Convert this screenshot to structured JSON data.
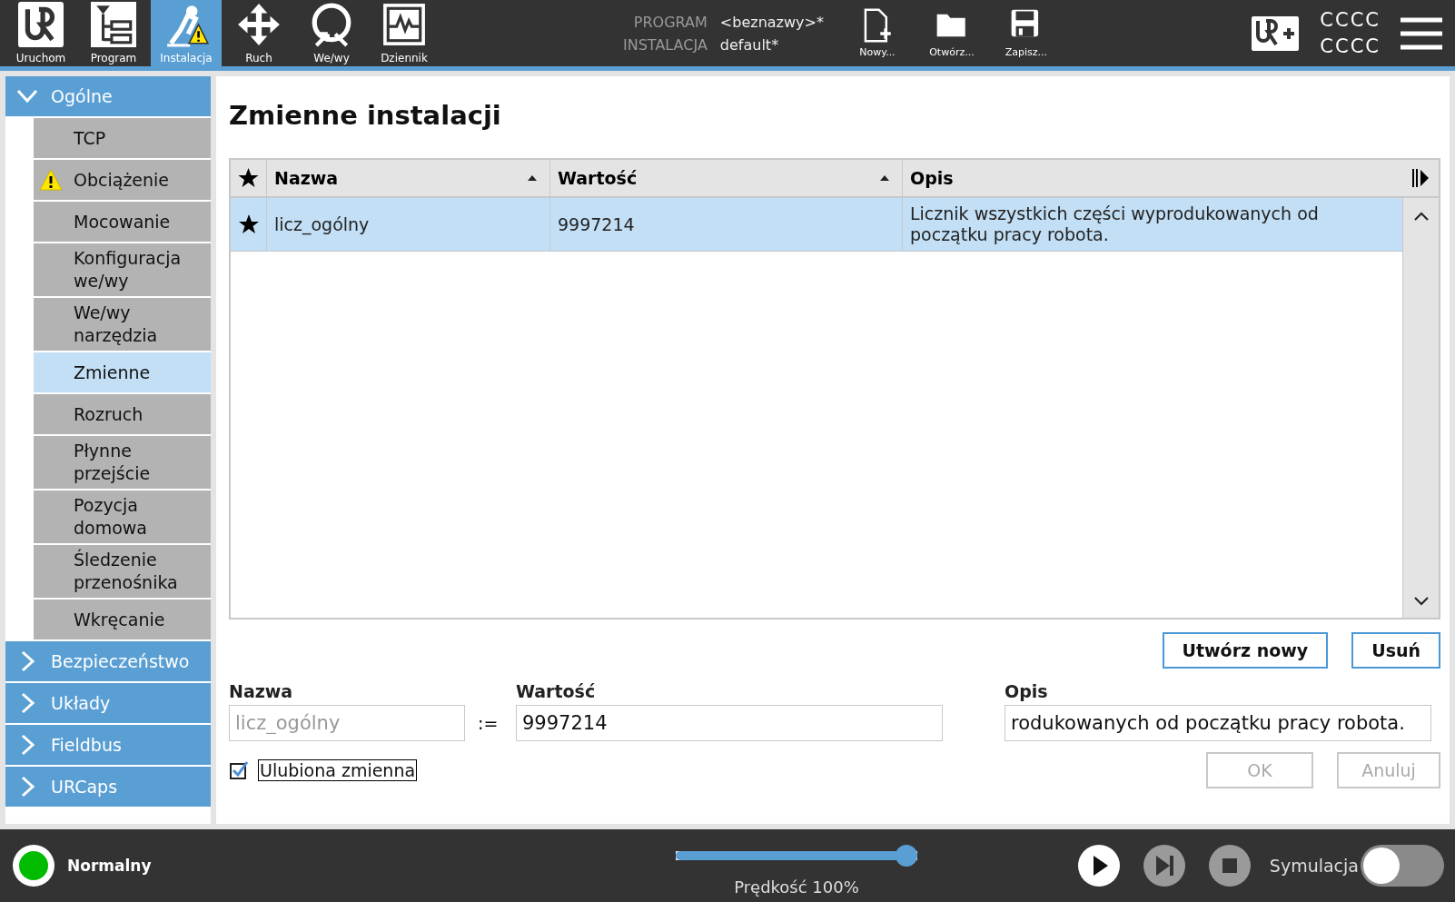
{
  "top_bar": {
    "nav_tabs": [
      {
        "label": "Uruchom",
        "selected": false
      },
      {
        "label": "Program",
        "selected": false
      },
      {
        "label": "Instalacja",
        "selected": true
      },
      {
        "label": "Ruch",
        "selected": false
      },
      {
        "label": "We/wy",
        "selected": false
      },
      {
        "label": "Dziennik",
        "selected": false
      }
    ],
    "program": {
      "label": "PROGRAM",
      "value": "<beznazwy>*"
    },
    "installation": {
      "label": "INSTALACJA",
      "value": "default*"
    },
    "file_buttons": [
      {
        "label": "Nowy..."
      },
      {
        "label": "Otwórz..."
      },
      {
        "label": "Zapisz..."
      }
    ],
    "code_lines": [
      "CCCC",
      "CCCC"
    ]
  },
  "sidebar": {
    "sections": [
      {
        "label": "Ogólne",
        "expanded": true,
        "children": [
          {
            "label": "TCP",
            "selected": false,
            "warning": false
          },
          {
            "label": "Obciążenie",
            "selected": false,
            "warning": true
          },
          {
            "label": "Mocowanie",
            "selected": false,
            "warning": false
          },
          {
            "label": "Konfiguracja we/wy",
            "selected": false,
            "warning": false
          },
          {
            "label": "We/wy narzędzia",
            "selected": false,
            "warning": false
          },
          {
            "label": "Zmienne",
            "selected": true,
            "warning": false
          },
          {
            "label": "Rozruch",
            "selected": false,
            "warning": false
          },
          {
            "label": "Płynne przejście",
            "selected": false,
            "warning": false
          },
          {
            "label": "Pozycja domowa",
            "selected": false,
            "warning": false
          },
          {
            "label": "Śledzenie przenośnika",
            "selected": false,
            "warning": false
          },
          {
            "label": "Wkręcanie",
            "selected": false,
            "warning": false
          }
        ]
      },
      {
        "label": "Bezpieczeństwo",
        "expanded": false
      },
      {
        "label": "Układy",
        "expanded": false
      },
      {
        "label": "Fieldbus",
        "expanded": false
      },
      {
        "label": "URCaps",
        "expanded": false
      }
    ]
  },
  "main": {
    "title": "Zmienne instalacji",
    "table": {
      "columns": [
        {
          "label": "Nazwa",
          "sorted": true
        },
        {
          "label": "Wartość",
          "sorted": true
        },
        {
          "label": "Opis",
          "sorted": false
        }
      ],
      "rows": [
        {
          "favorite": true,
          "name": "licz_ogólny",
          "value": "9997214",
          "description": "Licznik wszystkich części wyprodukowanych od początku pracy robota.",
          "selected": true
        }
      ]
    },
    "buttons": [
      "Utwórz nowy",
      "Usuń"
    ],
    "editor": {
      "name_label": "Nazwa",
      "name_value": "licz_ogólny",
      "assign": ":=",
      "value_label": "Wartość",
      "value": "9997214",
      "description_label": "Opis",
      "description_value": "rodukowanych od początku pracy robota.",
      "favorite": {
        "label": "Ulubiona zmienna",
        "checked": true
      },
      "ok": {
        "label": "OK",
        "disabled": true
      },
      "cancel": {
        "label": "Anuluj",
        "disabled": true
      }
    }
  },
  "status_bar": {
    "mode": "Normalny",
    "speed": {
      "level": 1,
      "label": "Prędkość 100%"
    },
    "simulation": {
      "label": "Symulacja",
      "on": false
    }
  }
}
